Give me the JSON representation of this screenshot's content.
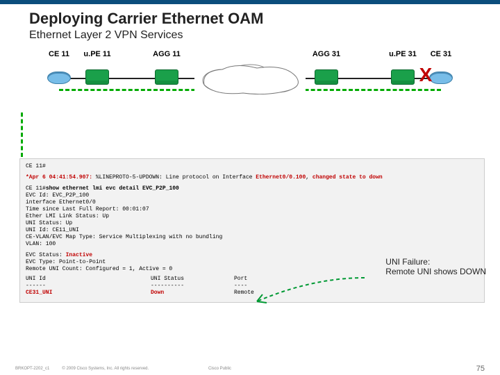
{
  "title": "Deploying Carrier Ethernet OAM",
  "subtitle": "Ethernet Layer 2 VPN Services",
  "devices": {
    "ce11": "CE 11",
    "upe11": "u.PE 11",
    "agg11": "AGG 11",
    "agg31": "AGG 31",
    "upe31": "u.PE 31",
    "ce31": "CE 31"
  },
  "fault_mark": "X",
  "cli": {
    "prompt1": "CE 11#",
    "log_ts": "*Apr  6 04:41:54.907:",
    "log_msg": " %LINEPROTO-5-UPDOWN: Line protocol on Interface ",
    "log_if": "Ethernet0/0.100",
    "log_tail": ", ",
    "log_state": "changed state to down",
    "prompt2": "CE 11#",
    "cmd": "show ethernet lmi evc detail EVC_P2P_100",
    "l1": "EVC Id: EVC_P2P_100",
    "l2": "interface Ethernet0/0",
    "l3": "  Time since Last Full Report: 00:01:07",
    "l4": "  Ether LMI Link Status: Up",
    "l5": "  UNI Status: Up",
    "l6": "  UNI Id: CE11_UNI",
    "l7": "  CE-VLAN/EVC Map Type: Service Multiplexing with no bundling",
    "l8": "  VLAN: 100",
    "l9a": "  EVC Status: ",
    "l9b": "Inactive",
    "l10": "  EVC Type: Point-to-Point",
    "l11": "  Remote UNI Count: Configured = 1, Active = 0",
    "tbl_h1": "  UNI Id",
    "tbl_h2": "UNI Status",
    "tbl_h3": "Port",
    "tbl_d1": "  ------",
    "tbl_d2": "----------",
    "tbl_d3": "----",
    "tbl_v1": "  CE31_UNI",
    "tbl_v2": "Down",
    "tbl_v3": "Remote"
  },
  "annot1": "UNI Failure:",
  "annot2": "Remote UNI shows DOWN",
  "footer": {
    "code": "BRKOPT-2202_c1",
    "copy": "© 2009 Cisco Systems, Inc. All rights reserved.",
    "pub": "Cisco Public",
    "page": "75"
  }
}
